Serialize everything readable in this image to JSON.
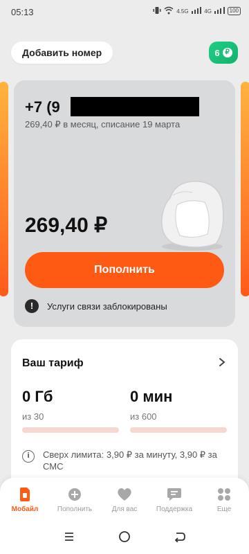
{
  "status_bar": {
    "time": "05:13",
    "net1": "4.5G",
    "net2": "4G",
    "battery": "100"
  },
  "header": {
    "add_number_label": "Добавить номер",
    "bonus_count": "6"
  },
  "account": {
    "phone_visible": "+7 (9",
    "billing_text": "269,40 ₽ в месяц, списание 19 марта",
    "balance": "269,40 ₽",
    "topup_label": "Пополнить",
    "warning": "Услуги связи заблокированы"
  },
  "tariff": {
    "title": "Ваш тариф",
    "data_amount": "0 Гб",
    "data_total": "из 30",
    "data_used_fraction": 0,
    "minutes_amount": "0 мин",
    "minutes_total": "из 600",
    "minutes_used_fraction": 0,
    "overlimit_text": "Сверх лимита: 3,90 ₽ за минуту, 3,90 ₽ за СМС"
  },
  "bottom_nav": {
    "items": [
      {
        "label": "Мобайл",
        "icon": "sim-icon",
        "active": true
      },
      {
        "label": "Пополнить",
        "icon": "plus-circle-icon",
        "active": false
      },
      {
        "label": "Для вас",
        "icon": "heart-icon",
        "active": false
      },
      {
        "label": "Поддержка",
        "icon": "chat-icon",
        "active": false
      },
      {
        "label": "Еще",
        "icon": "grid-icon",
        "active": false
      }
    ]
  },
  "colors": {
    "accent": "#ff5a14",
    "bonus": "#17b970",
    "card_bg": "#d9dadc",
    "track": "#f5d9d0"
  }
}
